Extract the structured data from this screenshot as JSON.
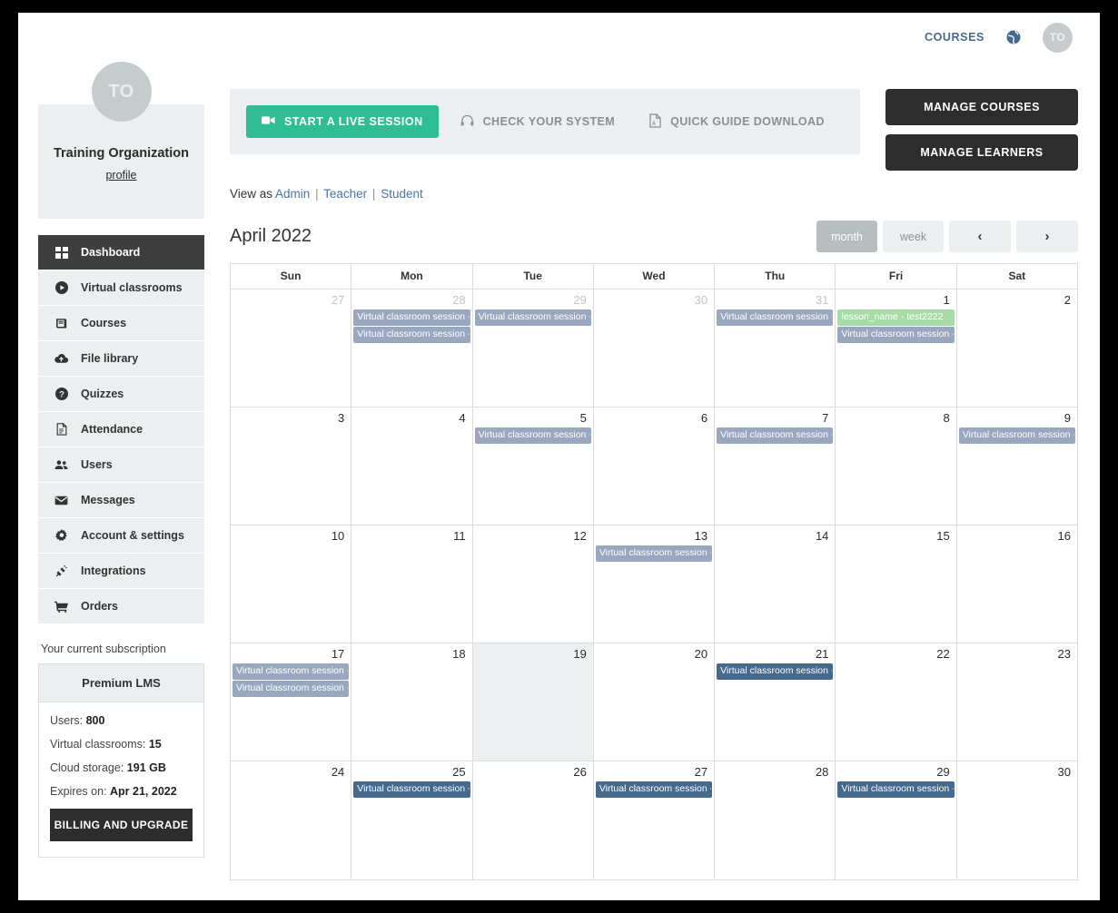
{
  "topbar": {
    "courses_label": "COURSES",
    "globe_icon": "globe-icon",
    "avatar_initials": "TO"
  },
  "profile": {
    "avatar_initials": "TO",
    "name": "Training Organization",
    "link_label": "profile"
  },
  "sidebar": {
    "items": [
      {
        "label": "Dashboard",
        "icon": "grid-icon",
        "active": true
      },
      {
        "label": "Virtual classrooms",
        "icon": "play-circle-icon",
        "active": false
      },
      {
        "label": "Courses",
        "icon": "book-icon",
        "active": false
      },
      {
        "label": "File library",
        "icon": "cloud-upload-icon",
        "active": false
      },
      {
        "label": "Quizzes",
        "icon": "question-circle-icon",
        "active": false
      },
      {
        "label": "Attendance",
        "icon": "document-icon",
        "active": false
      },
      {
        "label": "Users",
        "icon": "users-icon",
        "active": false
      },
      {
        "label": "Messages",
        "icon": "envelope-icon",
        "active": false
      },
      {
        "label": "Account & settings",
        "icon": "gear-icon",
        "active": false
      },
      {
        "label": "Integrations",
        "icon": "plug-icon",
        "active": false
      },
      {
        "label": "Orders",
        "icon": "cart-icon",
        "active": false
      }
    ],
    "subscription": {
      "section_label": "Your current subscription",
      "plan_name": "Premium LMS",
      "rows": [
        {
          "label": "Users:",
          "value": "800"
        },
        {
          "label": "Virtual classrooms:",
          "value": "15"
        },
        {
          "label": "Cloud storage:",
          "value": "191 GB"
        },
        {
          "label": "Expires on:",
          "value": "Apr 21, 2022"
        }
      ],
      "button_label": "BILLING AND UPGRADE"
    }
  },
  "actions": {
    "start_live_label": "START A LIVE SESSION",
    "start_live_icon": "video-camera-icon",
    "check_system_label": "CHECK YOUR SYSTEM",
    "check_system_icon": "headphones-icon",
    "quick_guide_label": "QUICK GUIDE DOWNLOAD",
    "quick_guide_icon": "pdf-file-icon",
    "manage_courses_label": "MANAGE COURSES",
    "manage_learners_label": "MANAGE LEARNERS"
  },
  "view_as": {
    "prefix": "View as",
    "roles": [
      "Admin",
      "Teacher",
      "Student"
    ],
    "separator": "|"
  },
  "calendar": {
    "title": "April 2022",
    "buttons": {
      "month": "month",
      "week": "week",
      "prev": "‹",
      "next": "›",
      "selected": "month"
    },
    "day_headers": [
      "Sun",
      "Mon",
      "Tue",
      "Wed",
      "Thu",
      "Fri",
      "Sat"
    ],
    "weeks": [
      [
        {
          "day": "27",
          "other": true,
          "today": false,
          "events": []
        },
        {
          "day": "28",
          "other": true,
          "today": false,
          "events": [
            {
              "title": "Virtual classroom session - A",
              "color": "muted"
            },
            {
              "title": "Virtual classroom session - ti",
              "color": "muted"
            }
          ]
        },
        {
          "day": "29",
          "other": true,
          "today": false,
          "events": [
            {
              "title": "Virtual classroom session - te",
              "color": "muted"
            }
          ]
        },
        {
          "day": "30",
          "other": true,
          "today": false,
          "events": []
        },
        {
          "day": "31",
          "other": true,
          "today": false,
          "events": [
            {
              "title": "Virtual classroom session - fo",
              "color": "muted"
            }
          ]
        },
        {
          "day": "1",
          "other": false,
          "today": false,
          "events": [
            {
              "title": "lesson_name - test2222",
              "color": "green"
            },
            {
              "title": "Virtual classroom session - ti",
              "color": "muted"
            }
          ]
        },
        {
          "day": "2",
          "other": false,
          "today": false,
          "events": []
        }
      ],
      [
        {
          "day": "3",
          "other": false,
          "today": false,
          "events": []
        },
        {
          "day": "4",
          "other": false,
          "today": false,
          "events": []
        },
        {
          "day": "5",
          "other": false,
          "today": false,
          "events": [
            {
              "title": "Virtual classroom session - ti",
              "color": "muted"
            }
          ]
        },
        {
          "day": "6",
          "other": false,
          "today": false,
          "events": []
        },
        {
          "day": "7",
          "other": false,
          "today": false,
          "events": [
            {
              "title": "Virtual classroom session - A",
              "color": "muted"
            }
          ]
        },
        {
          "day": "8",
          "other": false,
          "today": false,
          "events": []
        },
        {
          "day": "9",
          "other": false,
          "today": false,
          "events": [
            {
              "title": "Virtual classroom session - ti",
              "color": "muted"
            }
          ]
        }
      ],
      [
        {
          "day": "10",
          "other": false,
          "today": false,
          "events": []
        },
        {
          "day": "11",
          "other": false,
          "today": false,
          "events": []
        },
        {
          "day": "12",
          "other": false,
          "today": false,
          "events": []
        },
        {
          "day": "13",
          "other": false,
          "today": false,
          "events": [
            {
              "title": "Virtual classroom session - ti",
              "color": "muted"
            }
          ]
        },
        {
          "day": "14",
          "other": false,
          "today": false,
          "events": []
        },
        {
          "day": "15",
          "other": false,
          "today": false,
          "events": []
        },
        {
          "day": "16",
          "other": false,
          "today": false,
          "events": []
        }
      ],
      [
        {
          "day": "17",
          "other": false,
          "today": false,
          "events": [
            {
              "title": "Virtual classroom session - A",
              "color": "muted"
            },
            {
              "title": "Virtual classroom session - ti",
              "color": "muted"
            }
          ]
        },
        {
          "day": "18",
          "other": false,
          "today": false,
          "events": []
        },
        {
          "day": "19",
          "other": false,
          "today": true,
          "events": []
        },
        {
          "day": "20",
          "other": false,
          "today": false,
          "events": []
        },
        {
          "day": "21",
          "other": false,
          "today": false,
          "events": [
            {
              "title": "Virtual classroom session - ti",
              "color": "blue"
            }
          ]
        },
        {
          "day": "22",
          "other": false,
          "today": false,
          "events": []
        },
        {
          "day": "23",
          "other": false,
          "today": false,
          "events": []
        }
      ],
      [
        {
          "day": "24",
          "other": false,
          "today": false,
          "events": []
        },
        {
          "day": "25",
          "other": false,
          "today": false,
          "events": [
            {
              "title": "Virtual classroom session - ti",
              "color": "blue"
            }
          ]
        },
        {
          "day": "26",
          "other": false,
          "today": false,
          "events": []
        },
        {
          "day": "27",
          "other": false,
          "today": false,
          "events": [
            {
              "title": "Virtual classroom session - A",
              "color": "blue"
            }
          ]
        },
        {
          "day": "28",
          "other": false,
          "today": false,
          "events": []
        },
        {
          "day": "29",
          "other": false,
          "today": false,
          "events": [
            {
              "title": "Virtual classroom session - ti",
              "color": "blue"
            }
          ]
        },
        {
          "day": "30",
          "other": false,
          "today": false,
          "events": []
        }
      ]
    ]
  },
  "colors": {
    "accent_green": "#2fbd93",
    "event_blue": "#46698E",
    "event_muted": "#9aa8bf",
    "event_green": "#a8dba8",
    "dark": "#2d2d2d",
    "panel": "#eceff0"
  }
}
